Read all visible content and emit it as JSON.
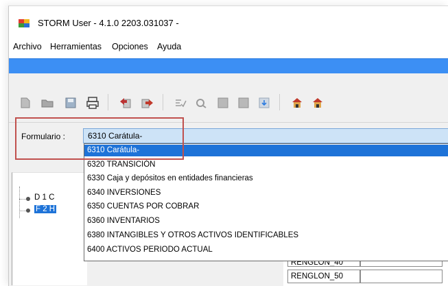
{
  "window": {
    "title": "STORM User - 4.1.0  2203.031037 -"
  },
  "menu": {
    "items": [
      "Archivo",
      "Herramientas",
      "Opciones",
      "Ayuda"
    ]
  },
  "toolbar": {
    "buttons": [
      "new-icon",
      "open-icon",
      "save-icon",
      "print-icon",
      "export-icon",
      "import-icon",
      "validate-icon",
      "settings-icon",
      "table-icon",
      "grid-icon",
      "download-icon",
      "house-icon",
      "house-icon"
    ]
  },
  "form": {
    "label": "Formulario :",
    "selected_value": "6310 Carátula-"
  },
  "dropdown": {
    "options": [
      "6310 Carátula-",
      "6320 TRANSICIÓN",
      "6330 Caja y depósitos en entidades financieras",
      "6340 INVERSIONES",
      "6350 CUENTAS POR COBRAR",
      "6360 INVENTARIOS",
      "6380 INTANGIBLES Y OTROS ACTIVOS IDENTIFICABLES",
      "6400 ACTIVOS PERIODO ACTUAL"
    ],
    "selected_index": 0
  },
  "tree": {
    "items": [
      "D 1 C",
      "F 2 H"
    ]
  },
  "grid": {
    "rows": [
      "RENGLON_40",
      "RENGLON_50"
    ]
  },
  "colors": {
    "accent_bar": "#3c8ff4",
    "selection": "#1e73d8",
    "combo_bg": "#cde3f7",
    "annotation_red": "#c0504d"
  }
}
